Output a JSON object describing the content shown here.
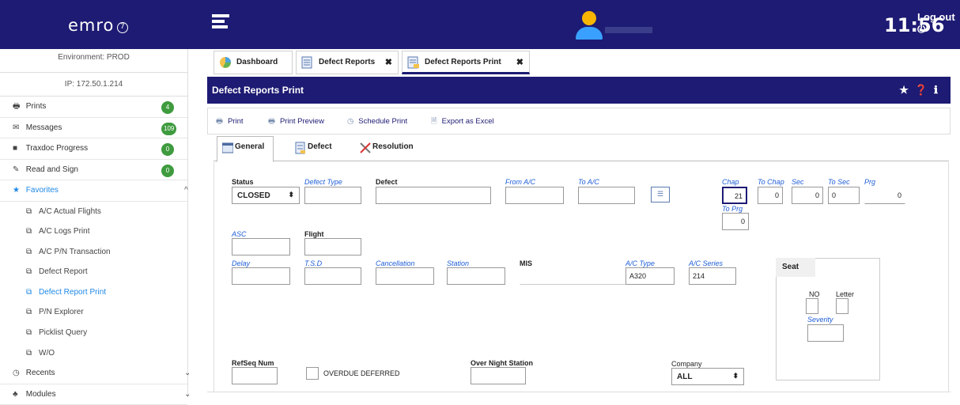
{
  "header": {
    "logo": "emro",
    "logo_badge": "7",
    "clock": "11:56",
    "logout_label": "Log out",
    "logout_icon": "power-icon"
  },
  "sidebar": {
    "environment": "Environment: PROD",
    "ip": "IP: 172.50.1.214",
    "items": [
      {
        "label": "Prints",
        "icon": "printer-icon",
        "badge": "4"
      },
      {
        "label": "Messages",
        "icon": "mail-icon",
        "badge": "109"
      },
      {
        "label": "Traxdoc Progress",
        "icon": "folder-icon",
        "badge": "0"
      },
      {
        "label": "Read and Sign",
        "icon": "pen-icon",
        "badge": "0"
      },
      {
        "label": "Favorites",
        "icon": "star-icon",
        "chevron": "^"
      }
    ],
    "favorites": [
      {
        "label": "A/C Actual Flights"
      },
      {
        "label": "A/C Logs Print"
      },
      {
        "label": "A/C P/N Transaction"
      },
      {
        "label": "Defect Report"
      },
      {
        "label": "Defect Report Print"
      },
      {
        "label": "P/N Explorer"
      },
      {
        "label": "Picklist Query"
      },
      {
        "label": "W/O"
      }
    ],
    "recents": "Recents",
    "modules": "Modules"
  },
  "tabs": [
    {
      "label": "Dashboard"
    },
    {
      "label": "Defect Reports"
    },
    {
      "label": "Defect Reports Print"
    }
  ],
  "title": "Defect Reports Print",
  "toolbar": {
    "print": "Print",
    "print_preview": "Print Preview",
    "schedule_print": "Schedule Print",
    "export_excel": "Export as Excel"
  },
  "subtabs": {
    "general": "General",
    "defect": "Defect",
    "resolution": "Resolution"
  },
  "form": {
    "status_label": "Status",
    "status_value": "CLOSED",
    "defect_type_label": "Defect Type",
    "defect_label": "Defect",
    "from_ac_label": "From A/C",
    "to_ac_label": "To A/C",
    "chap_label": "Chap",
    "chap_value": "21",
    "to_chap_label": "To Chap",
    "to_chap_value": "0",
    "sec_label": "Sec",
    "sec_value": "0",
    "to_sec_label": "To Sec",
    "to_sec_value": "0",
    "prg_label": "Prg",
    "prg_value": "0",
    "to_prg_label": "To Prg",
    "to_prg_value": "0",
    "asc_label": "ASC",
    "flight_label": "Flight",
    "delay_label": "Delay",
    "tsd_label": "T.S.D",
    "cancellation_label": "Cancellation",
    "station_label": "Station",
    "mis_label": "MIS",
    "ac_type_label": "A/C Type",
    "ac_type_value": "A320",
    "ac_series_label": "A/C Series",
    "ac_series_value": "214",
    "seat_label": "Seat",
    "no_label": "NO",
    "letter_label": "Letter",
    "severity_label": "Severity",
    "ref_seq_label": "RefSeq Num",
    "overdue_label": "OVERDUE DEFERRED",
    "overnight_label": "Over Night Station",
    "company_label": "Company",
    "company_value": "ALL"
  }
}
